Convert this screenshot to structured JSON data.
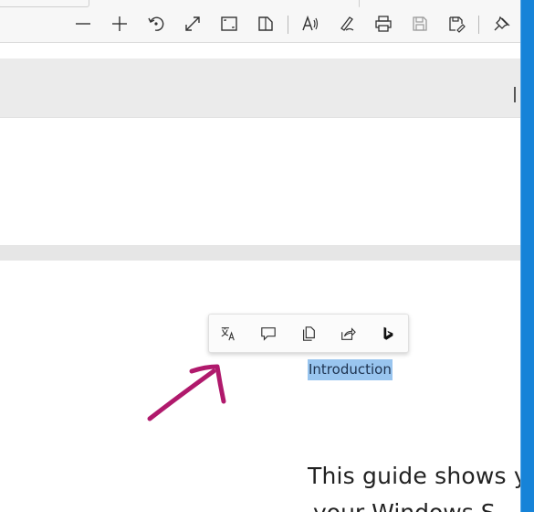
{
  "toolbar": {
    "buttons": [
      {
        "name": "zoom-out-icon"
      },
      {
        "name": "zoom-in-icon"
      },
      {
        "name": "rotate-icon"
      },
      {
        "name": "fit-to-page-icon"
      },
      {
        "name": "page-view-icon"
      },
      {
        "name": "two-page-icon"
      },
      {
        "name": "read-aloud-icon"
      },
      {
        "name": "draw-icon"
      },
      {
        "name": "print-icon"
      },
      {
        "name": "save-icon"
      },
      {
        "name": "save-as-icon"
      },
      {
        "name": "pin-toolbar-icon"
      }
    ]
  },
  "selection_toolbar": {
    "buttons": [
      {
        "name": "translate-icon"
      },
      {
        "name": "comment-icon"
      },
      {
        "name": "copy-icon"
      },
      {
        "name": "share-icon"
      },
      {
        "name": "bing-icon"
      }
    ]
  },
  "document": {
    "selected_text": "Introduction",
    "body_line_1": "This guide shows y",
    "body_line_2": "your Windows S"
  },
  "colors": {
    "highlight": "#99c5ef",
    "annotation_arrow": "#b0196c",
    "taskbar_accent": "#1683d8"
  }
}
